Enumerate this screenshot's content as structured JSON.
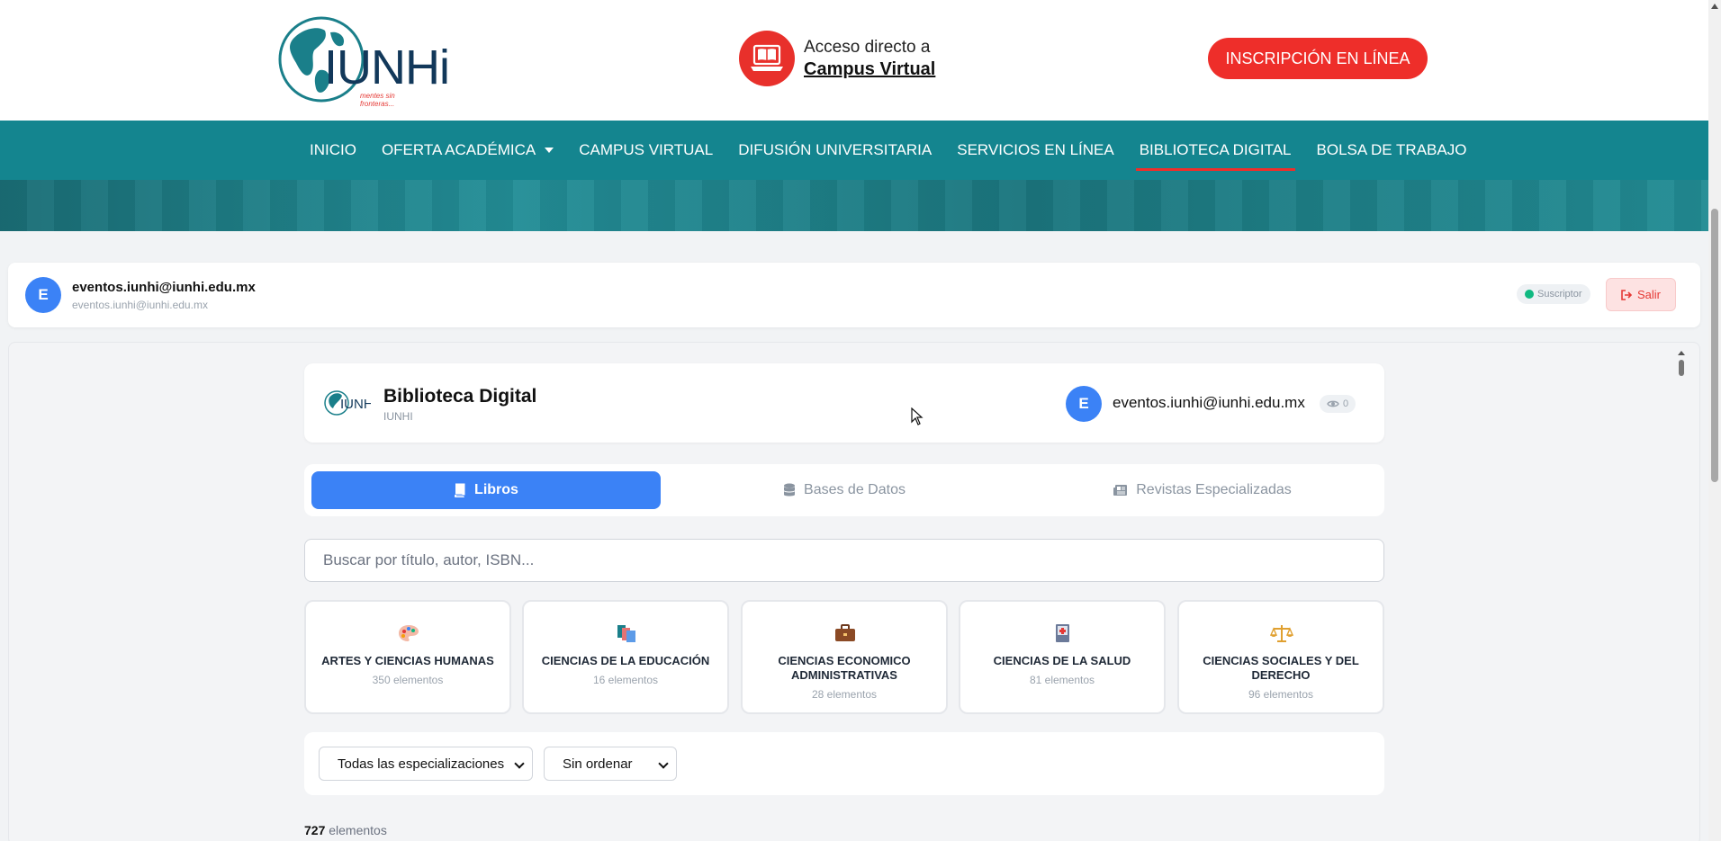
{
  "header": {
    "logo_text": "IUNHi",
    "logo_tagline": "mentes sin fronteras...",
    "campus_line1": "Acceso directo a",
    "campus_line2": "Campus Virtual",
    "enroll_label": "INSCRIPCIÓN EN LÍNEA"
  },
  "nav": {
    "items": [
      {
        "label": "INICIO"
      },
      {
        "label": "OFERTA ACADÉMICA"
      },
      {
        "label": "CAMPUS VIRTUAL"
      },
      {
        "label": "DIFUSIÓN UNIVERSITARIA"
      },
      {
        "label": "SERVICIOS EN LÍNEA"
      },
      {
        "label": "BIBLIOTECA DIGITAL"
      },
      {
        "label": "BOLSA DE TRABAJO"
      }
    ],
    "active": "BIBLIOTECA DIGITAL"
  },
  "userbar": {
    "avatar_letter": "E",
    "name": "eventos.iunhi@iunhi.edu.mx",
    "email": "eventos.iunhi@iunhi.edu.mx",
    "badge": "Suscriptor",
    "logout_label": "Salir"
  },
  "library": {
    "title": "Biblioteca Digital",
    "subtitle": "IUNHI",
    "avatar_letter": "E",
    "user_email": "eventos.iunhi@iunhi.edu.mx",
    "views": "0",
    "tabs": [
      {
        "label": "Libros",
        "active": true
      },
      {
        "label": "Bases de Datos",
        "active": false
      },
      {
        "label": "Revistas Especializadas",
        "active": false
      }
    ],
    "search_placeholder": "Buscar por título, autor, ISBN...",
    "categories": [
      {
        "name": "ARTES Y CIENCIAS HUMANAS",
        "count": "350 elementos",
        "icon": "palette-icon"
      },
      {
        "name": "CIENCIAS DE LA EDUCACIÓN",
        "count": "16 elementos",
        "icon": "books-icon"
      },
      {
        "name": "CIENCIAS ECONOMICO ADMINISTRATIVAS",
        "count": "28 elementos",
        "icon": "briefcase-icon"
      },
      {
        "name": "CIENCIAS DE LA SALUD",
        "count": "81 elementos",
        "icon": "medical-book-icon"
      },
      {
        "name": "CIENCIAS SOCIALES Y DEL DERECHO",
        "count": "96 elementos",
        "icon": "scales-icon"
      }
    ],
    "filter_specialization": "Todas las especializaciones",
    "filter_order": "Sin ordenar",
    "total_count": "727",
    "total_label": "elementos"
  },
  "colors": {
    "brand_teal": "#14858f",
    "brand_red": "#ee2e2a",
    "accent_blue": "#3b82f6"
  }
}
